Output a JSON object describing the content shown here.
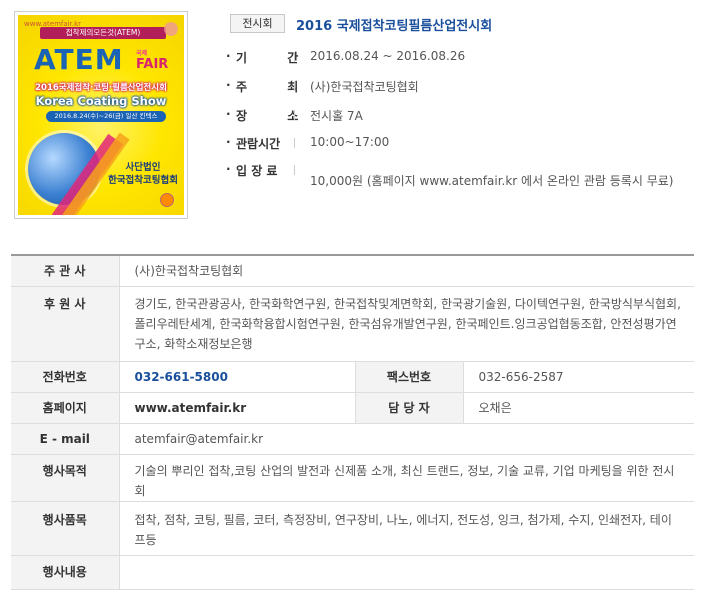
{
  "poster": {
    "top_text": "www.atemfair.kr",
    "tag": "접착제의모든것(ATEM)",
    "logo": "ATEM",
    "fair": "FAIR",
    "fair_small": "국제",
    "title_kr": "2016국제접착·코팅·필름산업전시회",
    "title_en": "Korea Coating Show",
    "dates": "2016.8.24(수)~26(금) 일산 킨텍스",
    "org_line1": "사단법인",
    "org_line2": "한국접착코팅협회"
  },
  "header": {
    "category": "전시회",
    "title": "2016 국제접착코팅필름산업전시회",
    "rows": [
      {
        "label": "기 간",
        "value": "2016.08.24 ~ 2016.08.26"
      },
      {
        "label": "주 최",
        "value": "(사)한국접착코팅협회"
      },
      {
        "label": "장 소",
        "value": "전시홀 7A"
      },
      {
        "label": "관람시간",
        "value": "10:00~17:00"
      },
      {
        "label": "입 장 료",
        "value": "10,000원 (홈페이지 www.atemfair.kr 에서 온라인 관람 등록시 무료)"
      }
    ]
  },
  "details": {
    "host_label": "주 관 사",
    "host": "(사)한국접착코팅협회",
    "sponsor_label": "후 원 사",
    "sponsors": "경기도, 한국관광공사, 한국화학연구원, 한국접착및계면학회, 한국광기술원, 다이텍연구원, 한국방식부식협회, 폴리우레탄세계, 한국화학융합시험연구원, 한국섬유개발연구원, 한국페인트.잉크공업협동조합, 안전성평가연구소, 화학소재정보은행",
    "phone_label": "전화번호",
    "phone": "032-661-5800",
    "fax_label": "팩스번호",
    "fax": "032-656-2587",
    "homepage_label": "홈페이지",
    "homepage": "www.atemfair.kr",
    "contact_label": "담 당 자",
    "contact": "오채은",
    "email_label": "E - mail",
    "email": "atemfair@atemfair.kr",
    "purpose_label": "행사목적",
    "purpose": "기술의 뿌리인 접착,코팅 산업의 발전과 신제품 소개, 최신 트랜드, 정보, 기술 교류, 기업 마케팅을 위한 전시회",
    "items_label": "행사품목",
    "items": "접착, 점착, 코팅, 필름, 코터, 측정장비, 연구장비, 나노, 에너지, 전도성, 잉크, 첨가제, 수지, 인쇄전자, 테이프등",
    "content_label": "행사내용",
    "content": ""
  }
}
